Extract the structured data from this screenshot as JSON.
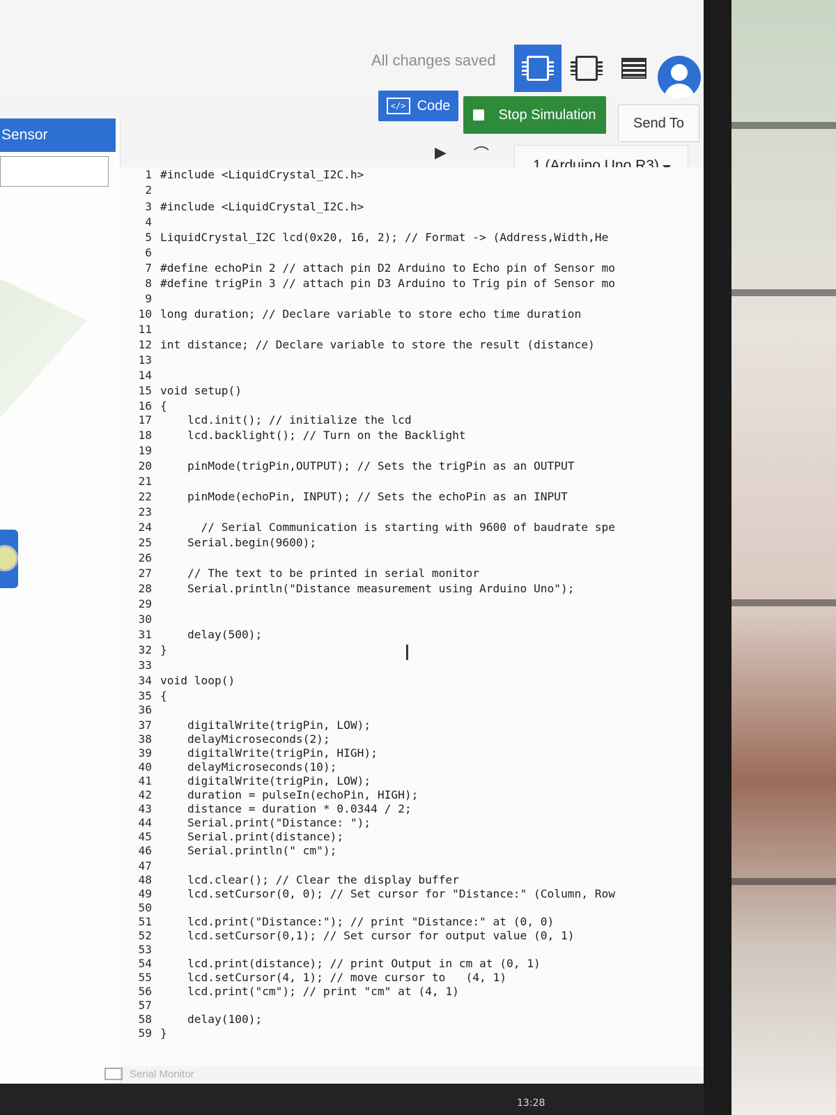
{
  "header": {
    "status": "All changes saved",
    "icons": [
      "circuit-view-icon",
      "component-icon",
      "list-view-icon",
      "user-avatar"
    ]
  },
  "toolbar": {
    "code_label": "Code",
    "code_icon_text": "</>",
    "stop_label": "Stop Simulation",
    "send_label": "Send To",
    "device": "1 (Arduino Uno R3)"
  },
  "sidebar": {
    "title": "Sensor",
    "field_value": ""
  },
  "editor": {
    "lines": [
      {
        "n": "1",
        "code": "#include <LiquidCrystal_I2C.h>"
      },
      {
        "n": "2",
        "code": ""
      },
      {
        "n": "3",
        "code": "#include <LiquidCrystal_I2C.h>"
      },
      {
        "n": "4",
        "code": ""
      },
      {
        "n": "5",
        "code": "LiquidCrystal_I2C lcd(0x20, 16, 2); // Format -> (Address,Width,He"
      },
      {
        "n": "6",
        "code": ""
      },
      {
        "n": "7",
        "code": "#define echoPin 2 // attach pin D2 Arduino to Echo pin of Sensor mo"
      },
      {
        "n": "8",
        "code": "#define trigPin 3 // attach pin D3 Arduino to Trig pin of Sensor mo"
      },
      {
        "n": "9",
        "code": ""
      },
      {
        "n": "10",
        "code": "long duration; // Declare variable to store echo time duration"
      },
      {
        "n": "11",
        "code": ""
      },
      {
        "n": "12",
        "code": "int distance; // Declare variable to store the result (distance)"
      },
      {
        "n": "13",
        "code": ""
      },
      {
        "n": "14",
        "code": ""
      },
      {
        "n": "15",
        "code": "void setup()"
      },
      {
        "n": "16",
        "code": "{"
      },
      {
        "n": "17",
        "code": "    lcd.init(); // initialize the lcd"
      },
      {
        "n": "18",
        "code": "    lcd.backlight(); // Turn on the Backlight"
      },
      {
        "n": "19",
        "code": ""
      },
      {
        "n": "20",
        "code": "    pinMode(trigPin,OUTPUT); // Sets the trigPin as an OUTPUT"
      },
      {
        "n": "21",
        "code": ""
      },
      {
        "n": "22",
        "code": "    pinMode(echoPin, INPUT); // Sets the echoPin as an INPUT"
      },
      {
        "n": "23",
        "code": ""
      },
      {
        "n": "24",
        "code": "      // Serial Communication is starting with 9600 of baudrate spe"
      },
      {
        "n": "25",
        "code": "    Serial.begin(9600);"
      },
      {
        "n": "26",
        "code": ""
      },
      {
        "n": "27",
        "code": "    // The text to be printed in serial monitor"
      },
      {
        "n": "28",
        "code": "    Serial.println(\"Distance measurement using Arduino Uno\");"
      },
      {
        "n": "29",
        "code": ""
      },
      {
        "n": "30",
        "code": ""
      },
      {
        "n": "31",
        "code": "    delay(500);"
      },
      {
        "n": "32",
        "code": "}"
      },
      {
        "n": "33",
        "code": ""
      },
      {
        "n": "34",
        "code": "void loop()"
      },
      {
        "n": "35",
        "code": "{"
      },
      {
        "n": "36",
        "code": ""
      },
      {
        "n": "37",
        "code": "    digitalWrite(trigPin, LOW);"
      },
      {
        "n": "38",
        "code": "    delayMicroseconds(2);"
      },
      {
        "n": "39",
        "code": "    digitalWrite(trigPin, HIGH);"
      },
      {
        "n": "40",
        "code": "    delayMicroseconds(10);"
      },
      {
        "n": "41",
        "code": "    digitalWrite(trigPin, LOW);"
      },
      {
        "n": "42",
        "code": "    duration = pulseIn(echoPin, HIGH);"
      },
      {
        "n": "43",
        "code": "    distance = duration * 0.0344 / 2;"
      },
      {
        "n": "44",
        "code": "    Serial.print(\"Distance: \");"
      },
      {
        "n": "45",
        "code": "    Serial.print(distance);"
      },
      {
        "n": "46",
        "code": "    Serial.println(\" cm\");"
      },
      {
        "n": "47",
        "code": ""
      },
      {
        "n": "48",
        "code": "    lcd.clear(); // Clear the display buffer"
      },
      {
        "n": "49",
        "code": "    lcd.setCursor(0, 0); // Set cursor for \"Distance:\" (Column, Row"
      },
      {
        "n": "50",
        "code": ""
      },
      {
        "n": "51",
        "code": "    lcd.print(\"Distance:\"); // print \"Distance:\" at (0, 0)"
      },
      {
        "n": "52",
        "code": "    lcd.setCursor(0,1); // Set cursor for output value (0, 1)"
      },
      {
        "n": "53",
        "code": ""
      },
      {
        "n": "54",
        "code": "    lcd.print(distance); // print Output in cm at (0, 1)"
      },
      {
        "n": "55",
        "code": "    lcd.setCursor(4, 1); // move cursor to   (4, 1)"
      },
      {
        "n": "56",
        "code": "    lcd.print(\"cm\"); // print \"cm\" at (4, 1)"
      },
      {
        "n": "57",
        "code": ""
      },
      {
        "n": "58",
        "code": "    delay(100);"
      },
      {
        "n": "59",
        "code": "}"
      }
    ]
  },
  "footer": {
    "serial_monitor": "Serial Monitor",
    "clock": "13:28"
  }
}
